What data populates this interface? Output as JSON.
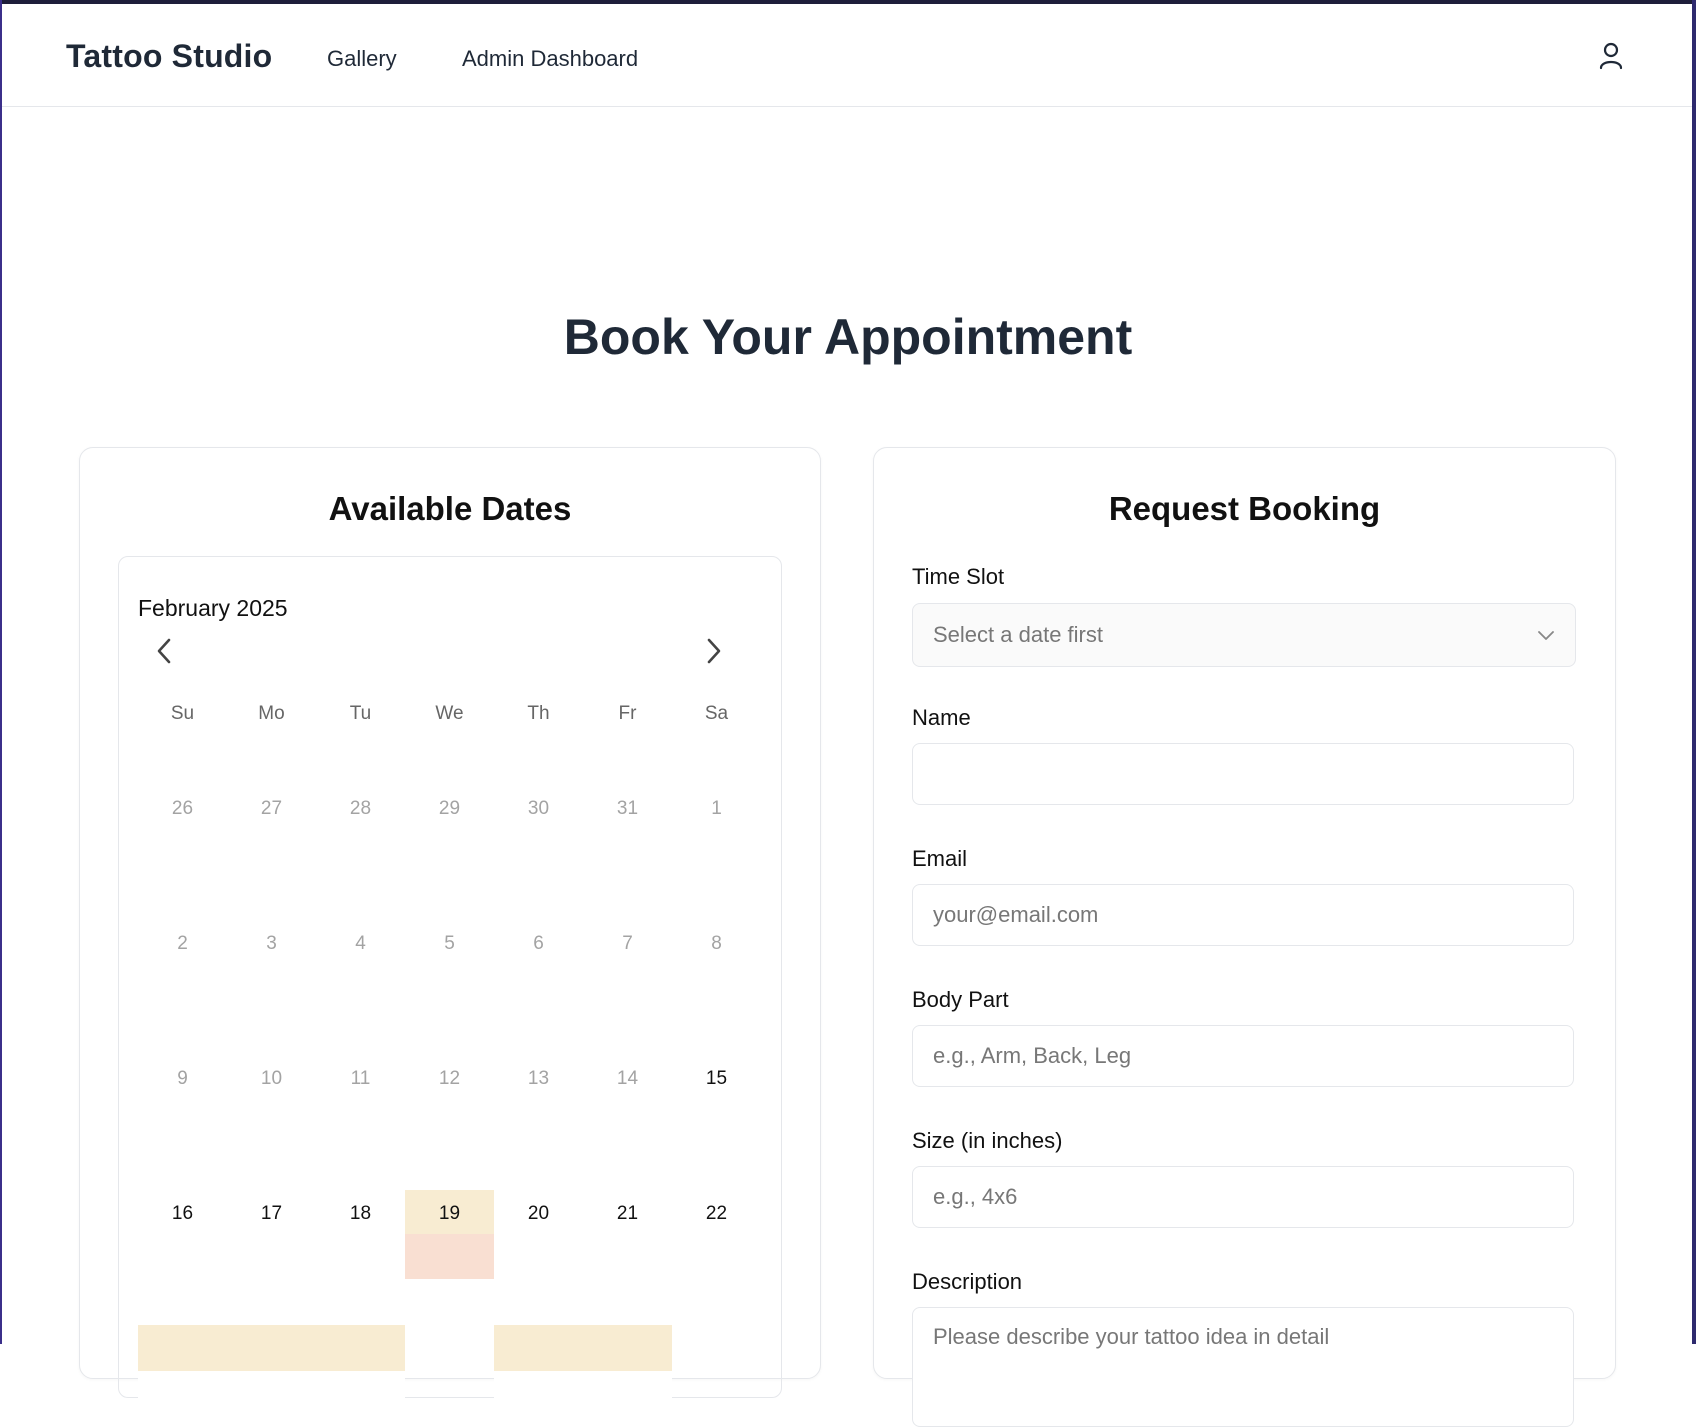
{
  "nav": {
    "brand": "Tattoo Studio",
    "links": [
      "Gallery",
      "Admin Dashboard"
    ],
    "user_icon": "user-icon"
  },
  "page": {
    "title": "Book Your Appointment"
  },
  "calendar_card": {
    "title": "Available Dates",
    "month_label": "February 2025",
    "prev_icon": "chevron-left-icon",
    "next_icon": "chevron-right-icon",
    "weekdays": [
      "Su",
      "Mo",
      "Tu",
      "We",
      "Th",
      "Fr",
      "Sa"
    ],
    "weeks": [
      [
        "26",
        "27",
        "28",
        "29",
        "30",
        "31",
        "1"
      ],
      [
        "2",
        "3",
        "4",
        "5",
        "6",
        "7",
        "8"
      ],
      [
        "9",
        "10",
        "11",
        "12",
        "13",
        "14",
        "15"
      ],
      [
        "16",
        "17",
        "18",
        "19",
        "20",
        "21",
        "22"
      ]
    ],
    "available_dates": [
      "15",
      "16",
      "17",
      "18",
      "19",
      "20",
      "21",
      "22"
    ],
    "highlighted_date": "19"
  },
  "booking_card": {
    "title": "Request Booking",
    "time_slot": {
      "label": "Time Slot",
      "value": "Select a date first",
      "icon": "chevron-down-icon"
    },
    "name": {
      "label": "Name",
      "value": "",
      "placeholder": ""
    },
    "email": {
      "label": "Email",
      "value": "",
      "placeholder": "your@email.com"
    },
    "body_part": {
      "label": "Body Part",
      "value": "",
      "placeholder": "e.g., Arm, Back, Leg"
    },
    "size": {
      "label": "Size (in inches)",
      "value": "",
      "placeholder": "e.g., 4x6"
    },
    "description": {
      "label": "Description",
      "value": "",
      "placeholder": "Please describe your tattoo idea in detail"
    }
  },
  "colors": {
    "heading": "#1f2937",
    "border": "#e5e7eb",
    "highlight_week": "#f8ecd2",
    "selected_day": "#f9dfd2",
    "frame": "#1e1e3a"
  }
}
